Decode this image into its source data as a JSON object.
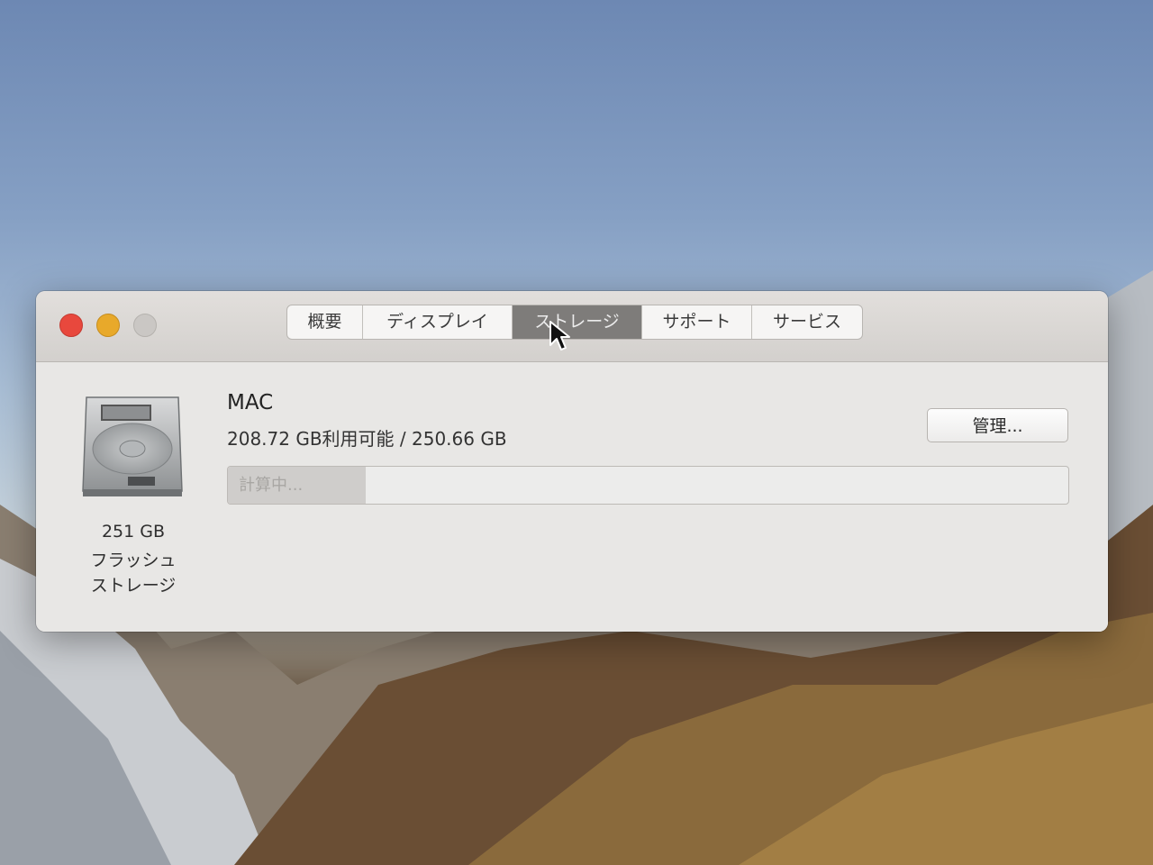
{
  "window": {
    "tabs": [
      {
        "label": "概要",
        "active": false
      },
      {
        "label": "ディスプレイ",
        "active": false
      },
      {
        "label": "ストレージ",
        "active": true
      },
      {
        "label": "サポート",
        "active": false
      },
      {
        "label": "サービス",
        "active": false
      }
    ]
  },
  "storage": {
    "disk": {
      "icon": "hard-drive-icon",
      "size": "251 GB",
      "type_line1": "フラッシュ",
      "type_line2": "ストレージ"
    },
    "volume_name": "MAC",
    "available_text": "208.72 GB利用可能 / 250.66 GB",
    "manage_label": "管理...",
    "bar_label": "計算中...",
    "bar_fill_fraction": 0.164
  },
  "colors": {
    "close": "#e8483d",
    "minimize": "#e8a92a",
    "zoom": "#cac7c4",
    "active_tab": "#7e7c7a"
  }
}
